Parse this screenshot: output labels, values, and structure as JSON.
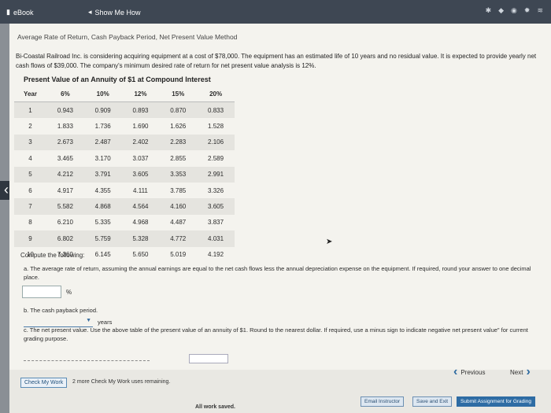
{
  "topbar": {
    "ebook_label": "eBook",
    "show_me_label": "Show Me How",
    "icons": [
      "star-icon",
      "diamond-icon",
      "eye-icon",
      "gear-icon",
      "wifi-icon"
    ]
  },
  "page": {
    "title": "Average Rate of Return, Cash Payback Period, Net Present Value Method",
    "intro": "Bi-Coastal Railroad Inc. is considering acquiring equipment at a cost of $78,000. The equipment has an estimated life of 10 years and no residual value. It is expected to provide yearly net cash flows of $39,000. The company's minimum desired rate of return for net present value analysis is 12%.",
    "pv_title": "Present Value of an Annuity of $1 at Compound Interest",
    "table": {
      "headers": [
        "Year",
        "6%",
        "10%",
        "12%",
        "15%",
        "20%"
      ],
      "rows": [
        [
          "1",
          "0.943",
          "0.909",
          "0.893",
          "0.870",
          "0.833"
        ],
        [
          "2",
          "1.833",
          "1.736",
          "1.690",
          "1.626",
          "1.528"
        ],
        [
          "3",
          "2.673",
          "2.487",
          "2.402",
          "2.283",
          "2.106"
        ],
        [
          "4",
          "3.465",
          "3.170",
          "3.037",
          "2.855",
          "2.589"
        ],
        [
          "5",
          "4.212",
          "3.791",
          "3.605",
          "3.353",
          "2.991"
        ],
        [
          "6",
          "4.917",
          "4.355",
          "4.111",
          "3.785",
          "3.326"
        ],
        [
          "7",
          "5.582",
          "4.868",
          "4.564",
          "4.160",
          "3.605"
        ],
        [
          "8",
          "6.210",
          "5.335",
          "4.968",
          "4.487",
          "3.837"
        ],
        [
          "9",
          "6.802",
          "5.759",
          "5.328",
          "4.772",
          "4.031"
        ],
        [
          "10",
          "7.360",
          "6.145",
          "5.650",
          "5.019",
          "4.192"
        ]
      ]
    },
    "compute_label": "Compute the following:",
    "qa": "a. The average rate of return, assuming the annual earnings are equal to the net cash flows less the annual depreciation expense on the equipment. If required, round your answer to one decimal place.",
    "qa_unit": "%",
    "qa_value": "",
    "qb": "b. The cash payback period.",
    "qb_unit": "years",
    "qb_value": "",
    "qc": "c. The net present value. Use the above table of the present value of an annuity of $1. Round to the nearest dollar. If required, use a minus sign to indicate negative net present value\" for current grading purpose.",
    "qc_value": ""
  },
  "footer": {
    "check_label": "Check My Work",
    "remaining": "2 more Check My Work uses remaining.",
    "previous_label": "Previous",
    "next_label": "Next",
    "saved": "All work saved.",
    "email_label": "Email Instructor",
    "save_exit_label": "Save and Exit",
    "submit_label": "Submit Assignment for Grading"
  }
}
